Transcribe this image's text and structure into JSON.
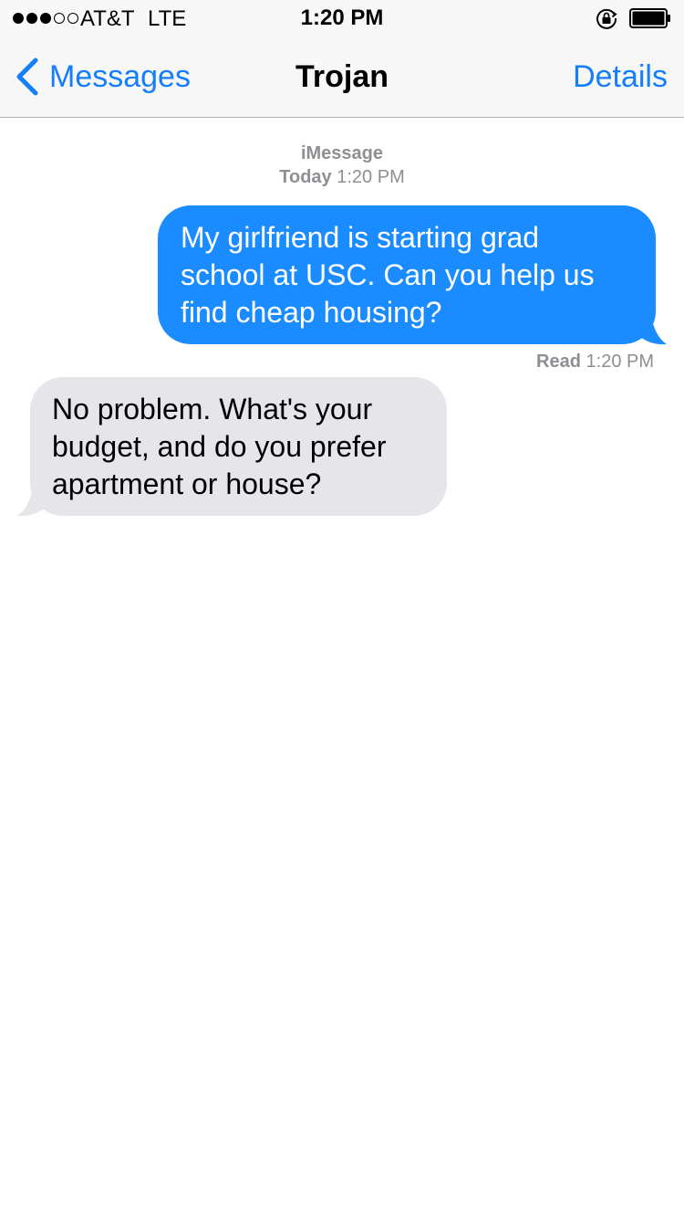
{
  "status_bar": {
    "signal_bars_filled": 3,
    "signal_bars_total": 5,
    "carrier": "AT&T",
    "network": "LTE",
    "time": "1:20 PM",
    "orientation_lock_icon": "orientation-lock-icon",
    "battery_icon": "battery-icon",
    "battery_level": 0.9
  },
  "nav": {
    "back_label": "Messages",
    "back_icon": "chevron-left-icon",
    "title": "Trojan",
    "details_label": "Details",
    "accent_color": "#147efb"
  },
  "conversation": {
    "service": "iMessage",
    "date_label": "Today",
    "date_time": "1:20 PM",
    "messages": [
      {
        "direction": "outgoing",
        "color": "#1a8cff",
        "lines": [
          "My girlfriend is starting grad",
          "school at USC. Can you help us",
          "find cheap housing?"
        ]
      },
      {
        "direction": "incoming",
        "color": "#e5e5ea",
        "lines": [
          "No problem. What's your",
          "budget, and do you prefer",
          "apartment or house?"
        ]
      }
    ],
    "receipt": {
      "label": "Read",
      "time": "1:20 PM"
    }
  }
}
